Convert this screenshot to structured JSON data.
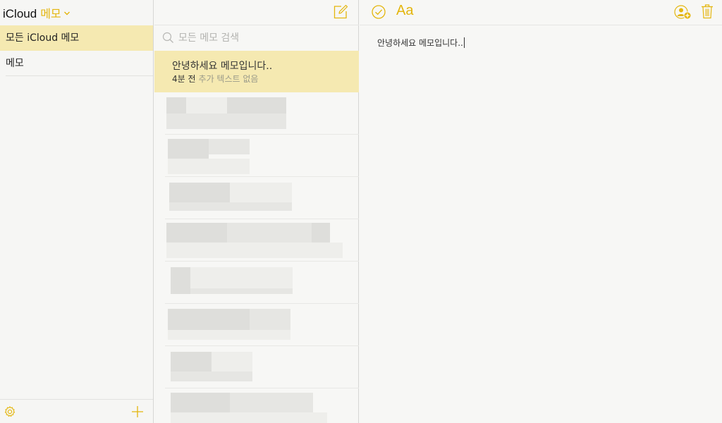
{
  "header": {
    "brand": "iCloud",
    "app_name": "메모"
  },
  "sidebar": {
    "items": [
      {
        "label": "모든 iCloud 메모",
        "active": true
      },
      {
        "label": "메모",
        "active": false
      }
    ]
  },
  "notelist": {
    "search_placeholder": "모든 메모 검색",
    "selected_note": {
      "title": "안녕하세요 메모입니다..",
      "time": "4분 전",
      "preview": "추가 텍스트 없음"
    }
  },
  "editor": {
    "format_label": "Aa",
    "body_text": "안녕하세요 메모입니다.."
  },
  "colors": {
    "accent": "#e4b60e",
    "selection": "#f5e9b1",
    "background": "#f7f7f5"
  },
  "icons": [
    "chevron-down-icon",
    "gear-icon",
    "plus-icon",
    "compose-icon",
    "search-icon",
    "checkmark-circle-icon",
    "add-person-icon",
    "trash-icon"
  ]
}
